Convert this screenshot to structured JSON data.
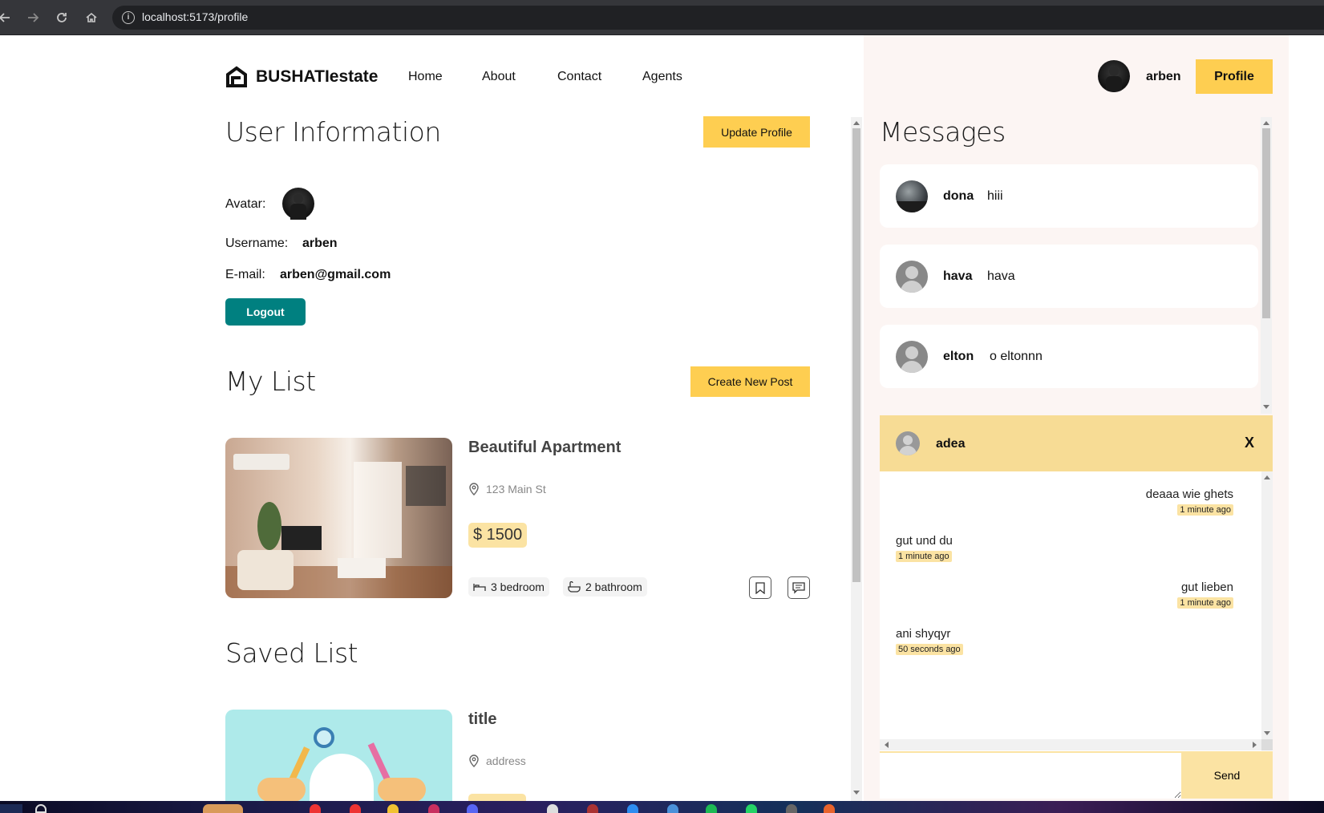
{
  "browser": {
    "url": "localhost:5173/profile"
  },
  "header": {
    "logo_text": "BUSHATIestate",
    "nav": [
      "Home",
      "About",
      "Contact",
      "Agents"
    ],
    "username": "arben",
    "profile_button": "Profile"
  },
  "user_info": {
    "title": "User Information",
    "update_button": "Update Profile",
    "avatar_label": "Avatar:",
    "username_label": "Username:",
    "username_value": "arben",
    "email_label": "E-mail:",
    "email_value": "arben@gmail.com",
    "logout_button": "Logout"
  },
  "my_list": {
    "title": "My List",
    "create_button": "Create New Post",
    "items": [
      {
        "title": "Beautiful Apartment",
        "address": "123 Main St",
        "price": "$ 1500",
        "bedroom": "3 bedroom",
        "bathroom": "2 bathroom"
      }
    ]
  },
  "saved_list": {
    "title": "Saved List",
    "items": [
      {
        "title": "title",
        "address": "address"
      }
    ]
  },
  "messages": {
    "title": "Messages",
    "conversations": [
      {
        "name": "dona",
        "last_message": "hiii"
      },
      {
        "name": "hava",
        "last_message": "hava"
      },
      {
        "name": "elton",
        "last_message": "o eltonnn"
      }
    ]
  },
  "chat": {
    "user": "adea",
    "close_label": "X",
    "messages": [
      {
        "text": "deaaa wie ghets",
        "time": "1 minute ago",
        "own": true
      },
      {
        "text": "gut und du",
        "time": "1 minute ago",
        "own": false
      },
      {
        "text": "gut lieben",
        "time": "1 minute ago",
        "own": true
      },
      {
        "text": "ani shyqyr",
        "time": "50 seconds ago",
        "own": false
      }
    ],
    "send_button": "Send"
  },
  "colors": {
    "accent": "#fece51",
    "accent_light": "#fbe3a3",
    "logout": "#008080",
    "panel_bg": "#fcf5f3"
  }
}
